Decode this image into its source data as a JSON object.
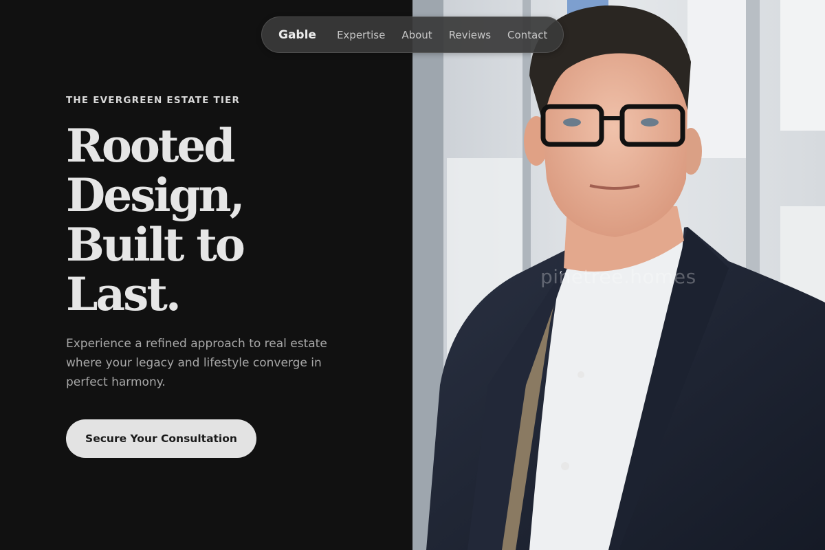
{
  "nav": {
    "brand": "Gable",
    "links": [
      "Expertise",
      "About",
      "Reviews",
      "Contact"
    ]
  },
  "hero": {
    "eyebrow": "THE EVERGREEN ESTATE TIER",
    "headline_lines": [
      "Rooted",
      "Design,",
      "Built to",
      "Last."
    ],
    "subtext": "Experience a refined approach to real estate where your legacy and lifestyle converge in perfect harmony.",
    "cta_label": "Secure Your Consultation"
  },
  "photo": {
    "subject": "portrait-of-man-in-navy-blazer-and-glasses",
    "watermark": "pinetree.homes"
  },
  "colors": {
    "background": "#111111",
    "headline": "#e6e6e6",
    "body_text": "#a8a8a8",
    "cta_background": "#e3e3e3",
    "nav_background": "#3a3a3a"
  }
}
